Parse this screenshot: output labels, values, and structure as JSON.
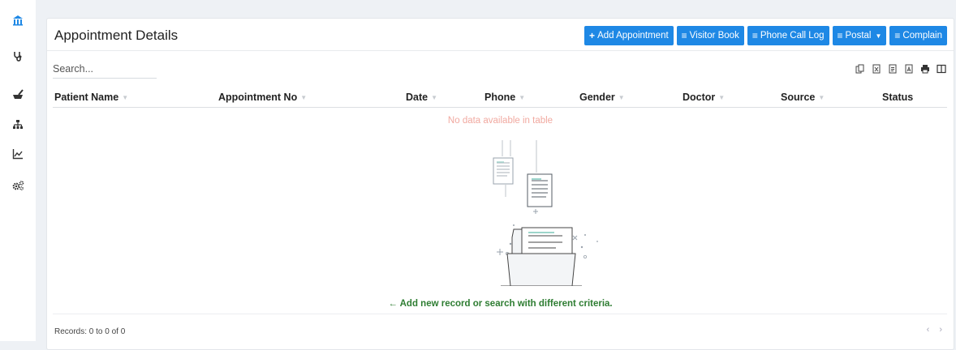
{
  "header": {
    "title": "Appointment Details",
    "buttons": {
      "add_appointment": "Add Appointment",
      "visitor_book": "Visitor Book",
      "phone_call_log": "Phone Call Log",
      "postal": "Postal",
      "complain": "Complain"
    }
  },
  "search": {
    "placeholder": "Search..."
  },
  "table": {
    "columns": [
      "Patient Name",
      "Appointment No",
      "Date",
      "Phone",
      "Gender",
      "Doctor",
      "Source",
      "Status"
    ],
    "empty_message": "No data available in table"
  },
  "hint": "Add new record or search with different criteria.",
  "footer": {
    "records": "Records: 0 to 0 of 0"
  },
  "sidebar": {
    "items": [
      "building-icon",
      "stethoscope-icon",
      "mortar-pestle-icon",
      "sitemap-icon",
      "line-chart-icon",
      "cogs-icon"
    ]
  },
  "colors": {
    "primary": "#1e88e5",
    "empty_text": "#f1a9a0",
    "hint_text": "#2e7d32"
  }
}
